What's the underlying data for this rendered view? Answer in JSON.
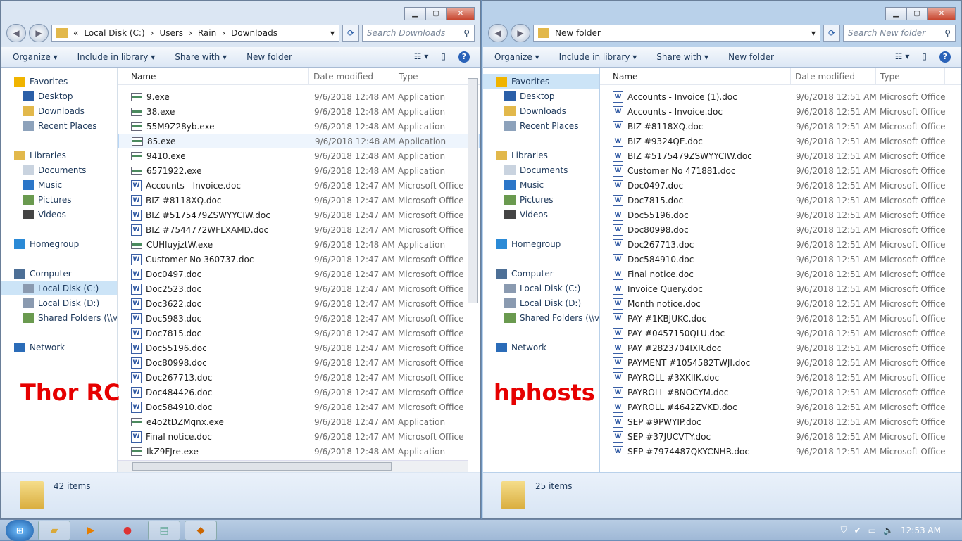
{
  "left": {
    "breadcrumb": [
      "«",
      "Local Disk (C:)",
      "Users",
      "Rain",
      "Downloads"
    ],
    "search_placeholder": "Search Downloads",
    "overlay_label": "Thor RC",
    "status": "42 items",
    "files": [
      [
        "9.exe",
        "9/6/2018 12:48 AM",
        "Application",
        "exe"
      ],
      [
        "38.exe",
        "9/6/2018 12:48 AM",
        "Application",
        "exe"
      ],
      [
        "55M9Z28yb.exe",
        "9/6/2018 12:48 AM",
        "Application",
        "exe"
      ],
      [
        "85.exe",
        "9/6/2018 12:48 AM",
        "Application",
        "exe"
      ],
      [
        "9410.exe",
        "9/6/2018 12:48 AM",
        "Application",
        "exe"
      ],
      [
        "6571922.exe",
        "9/6/2018 12:48 AM",
        "Application",
        "exe"
      ],
      [
        "Accounts - Invoice.doc",
        "9/6/2018 12:47 AM",
        "Microsoft Office ...",
        "doc"
      ],
      [
        "BIZ #8118XQ.doc",
        "9/6/2018 12:47 AM",
        "Microsoft Office ...",
        "doc"
      ],
      [
        "BIZ #5175479ZSWYYCIW.doc",
        "9/6/2018 12:47 AM",
        "Microsoft Office ...",
        "doc"
      ],
      [
        "BIZ #7544772WFLXAMD.doc",
        "9/6/2018 12:47 AM",
        "Microsoft Office ...",
        "doc"
      ],
      [
        "CUHluyjztW.exe",
        "9/6/2018 12:48 AM",
        "Application",
        "exe"
      ],
      [
        "Customer No 360737.doc",
        "9/6/2018 12:47 AM",
        "Microsoft Office ...",
        "doc"
      ],
      [
        "Doc0497.doc",
        "9/6/2018 12:47 AM",
        "Microsoft Office ...",
        "doc"
      ],
      [
        "Doc2523.doc",
        "9/6/2018 12:47 AM",
        "Microsoft Office ...",
        "doc"
      ],
      [
        "Doc3622.doc",
        "9/6/2018 12:47 AM",
        "Microsoft Office ...",
        "doc"
      ],
      [
        "Doc5983.doc",
        "9/6/2018 12:47 AM",
        "Microsoft Office ...",
        "doc"
      ],
      [
        "Doc7815.doc",
        "9/6/2018 12:47 AM",
        "Microsoft Office ...",
        "doc"
      ],
      [
        "Doc55196.doc",
        "9/6/2018 12:47 AM",
        "Microsoft Office ...",
        "doc"
      ],
      [
        "Doc80998.doc",
        "9/6/2018 12:47 AM",
        "Microsoft Office ...",
        "doc"
      ],
      [
        "Doc267713.doc",
        "9/6/2018 12:47 AM",
        "Microsoft Office ...",
        "doc"
      ],
      [
        "Doc484426.doc",
        "9/6/2018 12:47 AM",
        "Microsoft Office ...",
        "doc"
      ],
      [
        "Doc584910.doc",
        "9/6/2018 12:47 AM",
        "Microsoft Office ...",
        "doc"
      ],
      [
        "e4o2tDZMqnx.exe",
        "9/6/2018 12:47 AM",
        "Application",
        "exe"
      ],
      [
        "Final notice.doc",
        "9/6/2018 12:47 AM",
        "Microsoft Office ...",
        "doc"
      ],
      [
        "IkZ9FJre.exe",
        "9/6/2018 12:48 AM",
        "Application",
        "exe"
      ]
    ]
  },
  "right": {
    "breadcrumb": [
      "New folder"
    ],
    "search_placeholder": "Search New folder",
    "overlay_label": "hphosts",
    "status": "25 items",
    "files": [
      [
        "Accounts - Invoice (1).doc",
        "9/6/2018 12:51 AM",
        "Microsoft Office ...",
        "doc"
      ],
      [
        "Accounts - Invoice.doc",
        "9/6/2018 12:51 AM",
        "Microsoft Office ...",
        "doc"
      ],
      [
        "BIZ #8118XQ.doc",
        "9/6/2018 12:51 AM",
        "Microsoft Office ...",
        "doc"
      ],
      [
        "BIZ #9324QE.doc",
        "9/6/2018 12:51 AM",
        "Microsoft Office ...",
        "doc"
      ],
      [
        "BIZ #5175479ZSWYYCIW.doc",
        "9/6/2018 12:51 AM",
        "Microsoft Office ...",
        "doc"
      ],
      [
        "Customer No 471881.doc",
        "9/6/2018 12:51 AM",
        "Microsoft Office ...",
        "doc"
      ],
      [
        "Doc0497.doc",
        "9/6/2018 12:51 AM",
        "Microsoft Office ...",
        "doc"
      ],
      [
        "Doc7815.doc",
        "9/6/2018 12:51 AM",
        "Microsoft Office ...",
        "doc"
      ],
      [
        "Doc55196.doc",
        "9/6/2018 12:51 AM",
        "Microsoft Office ...",
        "doc"
      ],
      [
        "Doc80998.doc",
        "9/6/2018 12:51 AM",
        "Microsoft Office ...",
        "doc"
      ],
      [
        "Doc267713.doc",
        "9/6/2018 12:51 AM",
        "Microsoft Office ...",
        "doc"
      ],
      [
        "Doc584910.doc",
        "9/6/2018 12:51 AM",
        "Microsoft Office ...",
        "doc"
      ],
      [
        "Final notice.doc",
        "9/6/2018 12:51 AM",
        "Microsoft Office ...",
        "doc"
      ],
      [
        "Invoice Query.doc",
        "9/6/2018 12:51 AM",
        "Microsoft Office ...",
        "doc"
      ],
      [
        "Month notice.doc",
        "9/6/2018 12:51 AM",
        "Microsoft Office ...",
        "doc"
      ],
      [
        "PAY #1KBJUKC.doc",
        "9/6/2018 12:51 AM",
        "Microsoft Office ...",
        "doc"
      ],
      [
        "PAY #0457150QLU.doc",
        "9/6/2018 12:51 AM",
        "Microsoft Office ...",
        "doc"
      ],
      [
        "PAY #2823704IXR.doc",
        "9/6/2018 12:51 AM",
        "Microsoft Office ...",
        "doc"
      ],
      [
        "PAYMENT #1054582TWJI.doc",
        "9/6/2018 12:51 AM",
        "Microsoft Office ...",
        "doc"
      ],
      [
        "PAYROLL #3XKIIK.doc",
        "9/6/2018 12:51 AM",
        "Microsoft Office ...",
        "doc"
      ],
      [
        "PAYROLL #8NOCYM.doc",
        "9/6/2018 12:51 AM",
        "Microsoft Office ...",
        "doc"
      ],
      [
        "PAYROLL #4642ZVKD.doc",
        "9/6/2018 12:51 AM",
        "Microsoft Office ...",
        "doc"
      ],
      [
        "SEP #9PWYIP.doc",
        "9/6/2018 12:51 AM",
        "Microsoft Office ...",
        "doc"
      ],
      [
        "SEP #37JUCVTY.doc",
        "9/6/2018 12:51 AM",
        "Microsoft Office ...",
        "doc"
      ],
      [
        "SEP #7974487QKYCNHR.doc",
        "9/6/2018 12:51 AM",
        "Microsoft Office ...",
        "doc"
      ]
    ]
  },
  "toolbar": {
    "organize": "Organize ▾",
    "include": "Include in library ▾",
    "share": "Share with ▾",
    "new_folder": "New folder"
  },
  "columns": {
    "name": "Name",
    "date": "Date modified",
    "type": "Type"
  },
  "nav": [
    [
      "Favorites",
      "h",
      "#f0b400"
    ],
    [
      "Desktop",
      "",
      "#2b5fa8"
    ],
    [
      "Downloads",
      "",
      "#e2b84b"
    ],
    [
      "Recent Places",
      "",
      "#8da2bb"
    ],
    [
      "",
      "gap",
      ""
    ],
    [
      "Libraries",
      "h",
      "#e2b84b"
    ],
    [
      "Documents",
      "",
      "#c9d3df"
    ],
    [
      "Music",
      "",
      "#2b76c8"
    ],
    [
      "Pictures",
      "",
      "#6a9a4f"
    ],
    [
      "Videos",
      "",
      "#444"
    ],
    [
      "",
      "gap",
      ""
    ],
    [
      "Homegroup",
      "h",
      "#2b8ad6"
    ],
    [
      "",
      "gap",
      ""
    ],
    [
      "Computer",
      "h",
      "#4d6f96"
    ],
    [
      "Local Disk (C:)",
      "",
      "#8a9ab0"
    ],
    [
      "Local Disk (D:)",
      "",
      "#8a9ab0"
    ],
    [
      "Shared Folders (\\\\vm",
      "",
      "#6a9a4f"
    ],
    [
      "",
      "gap",
      ""
    ],
    [
      "Network",
      "h",
      "#2b6cb8"
    ]
  ],
  "taskbar": {
    "clock": "12:53 AM"
  }
}
